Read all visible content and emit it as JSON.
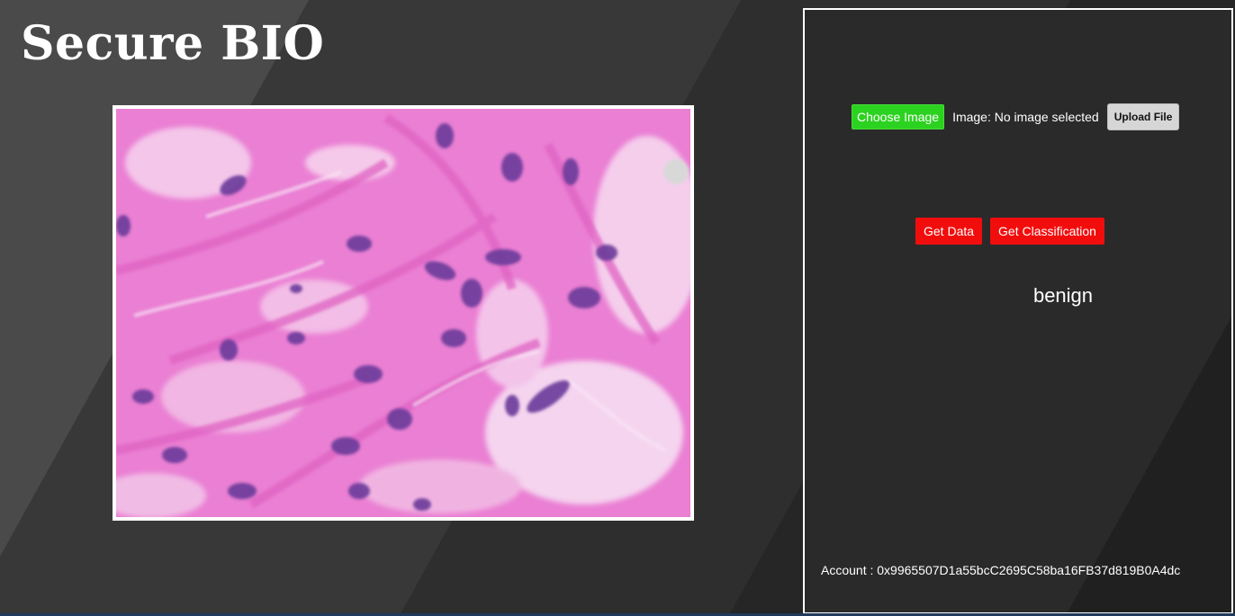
{
  "header": {
    "title": "Secure BIO"
  },
  "preview": {
    "description_icon": "histology-slide-image"
  },
  "panel": {
    "choose_label": "Choose Image",
    "image_status": "Image: No image selected",
    "upload_label": "Upload File",
    "get_data_label": "Get Data",
    "get_classification_label": "Get Classification",
    "result": "benign",
    "account": "Account : 0x9965507D1a55bcC2695C58ba16FB37d819B0A4dc"
  },
  "colors": {
    "choose_button": "#2bd21f",
    "action_buttons": "#f20d0d",
    "background": "#2b2b2b"
  }
}
